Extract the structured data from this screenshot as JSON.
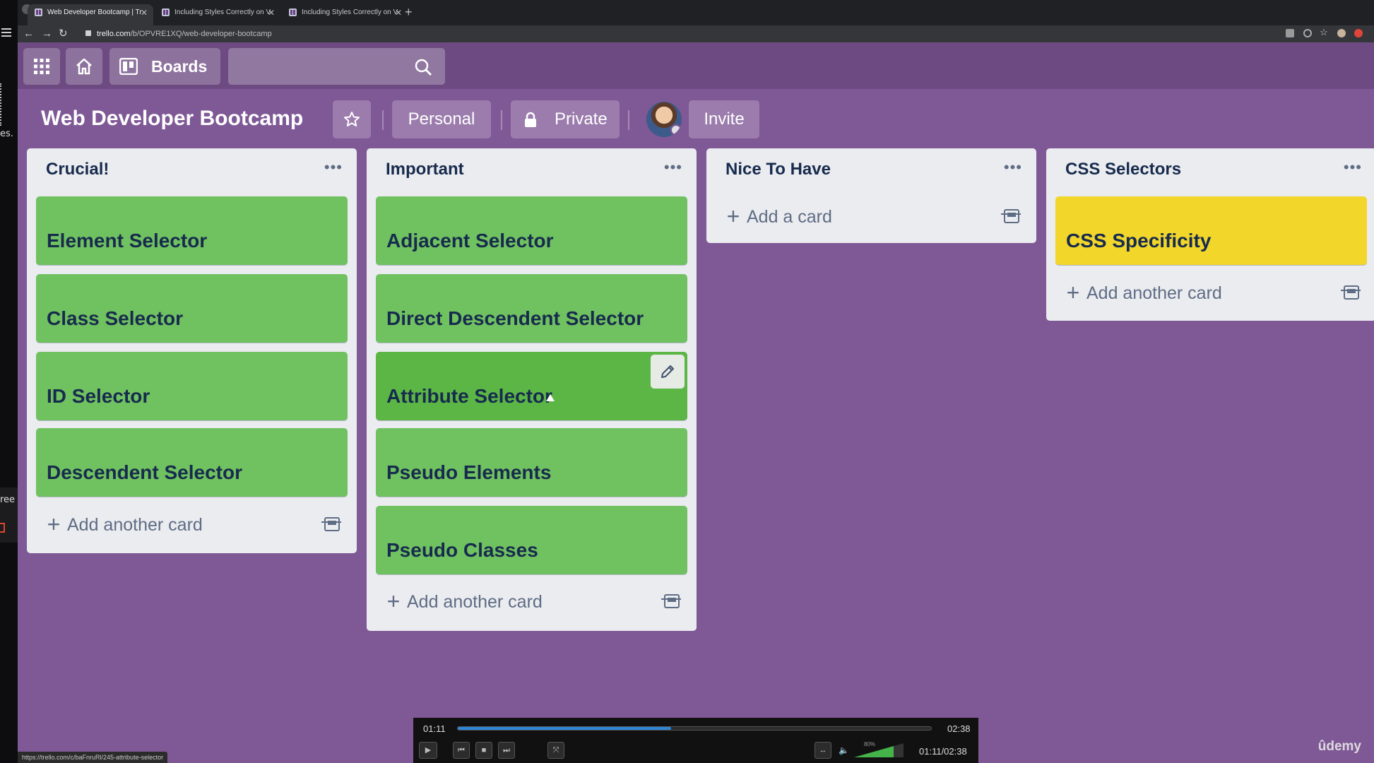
{
  "browser": {
    "tabs": [
      {
        "title": "Web Developer Bootcamp | Tr"
      },
      {
        "title": "Including Styles Correctly on V"
      },
      {
        "title": "Including Styles Correctly on V"
      }
    ],
    "url_domain": "trello.com",
    "url_path": "/b/OPVRE1XQ/web-developer-bootcamp",
    "status_url": "https://trello.com/c/baFnruRl/245-attribute-selector"
  },
  "desktop": {
    "fragment_top": "es.",
    "fragment_bottom": "ree"
  },
  "topbar": {
    "boards_label": "Boards"
  },
  "board": {
    "title": "Web Developer Bootcamp",
    "visibility_team": "Personal",
    "privacy": "Private",
    "invite": "Invite",
    "lists": [
      {
        "title": "Crucial!",
        "cards": [
          "Element Selector",
          "Class Selector",
          "ID Selector",
          "Descendent Selector"
        ],
        "add_label": "Add another card"
      },
      {
        "title": "Important",
        "cards": [
          "Adjacent Selector",
          "Direct Descendent Selector",
          "Attribute Selector",
          "Pseudo Elements",
          "Pseudo Classes"
        ],
        "add_label": "Add another card"
      },
      {
        "title": "Nice To Have",
        "cards": [],
        "add_label": "Add a card"
      },
      {
        "title": "CSS Selectors",
        "cards": [
          "CSS Specificity"
        ],
        "add_label": "Add another card"
      }
    ]
  },
  "player": {
    "current": "01:11",
    "total": "02:38",
    "combined": "01:11/02:38",
    "progress_fraction": 0.45,
    "volume_label": "80%"
  },
  "watermark": "ûdemy",
  "colors": {
    "board_bg": "#7f5896",
    "card_green": "#70c160",
    "card_yellow": "#f2d62a"
  }
}
